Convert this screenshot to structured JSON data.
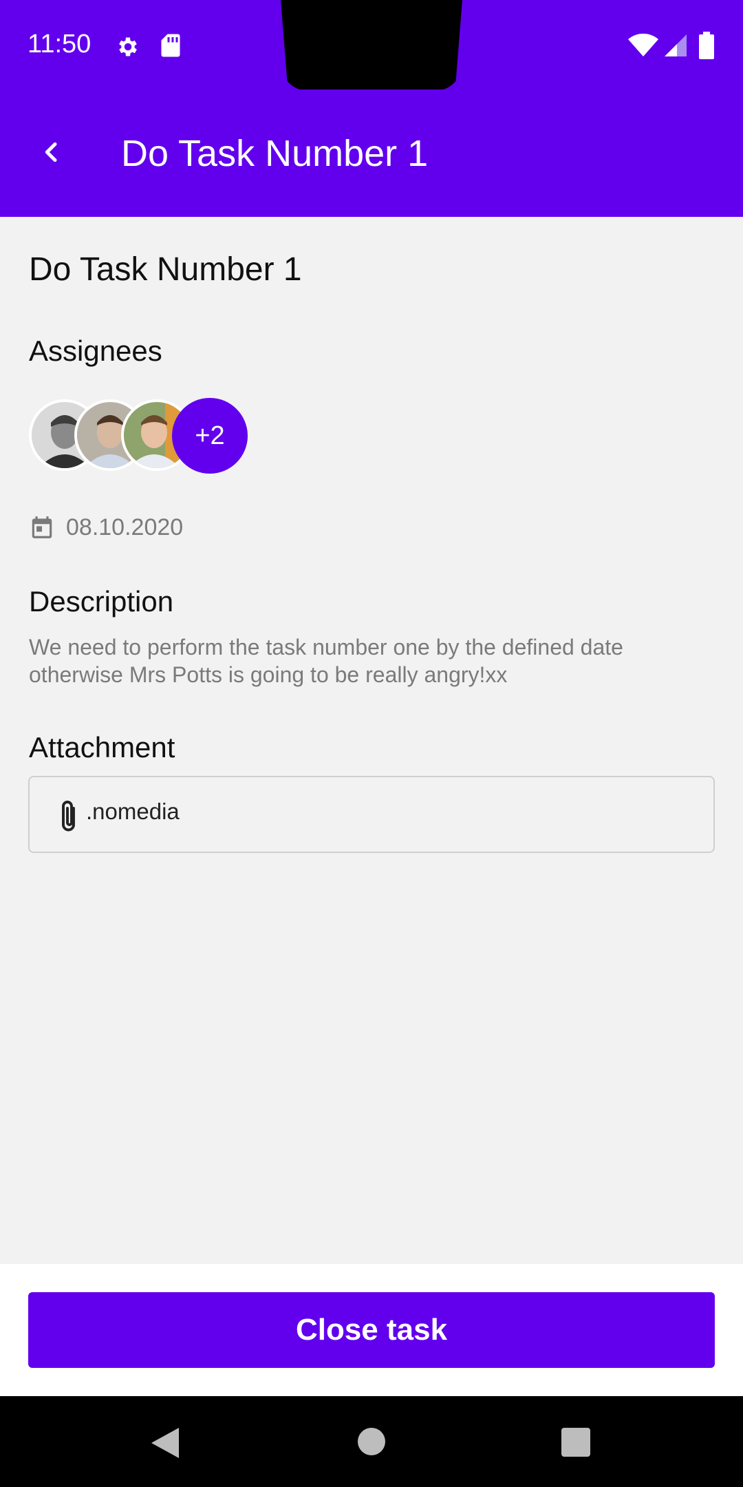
{
  "status_bar": {
    "time": "11:50",
    "icons": [
      "settings-icon",
      "sd-card-icon",
      "wifi-icon",
      "signal-icon",
      "battery-icon"
    ],
    "color": "#6200ee"
  },
  "app_bar": {
    "back_icon": "chevron-left-icon",
    "title": "Do Task Number 1"
  },
  "task": {
    "title": "Do Task Number 1",
    "assignees_heading": "Assignees",
    "assignees": {
      "avatars": [
        "avatar-person-1",
        "avatar-person-2",
        "avatar-person-3"
      ],
      "more_count": "+2"
    },
    "date": "08.10.2020",
    "description_heading": "Description",
    "description": "We need to perform the task number one by the defined date otherwise Mrs Potts is going to be really angry!xx",
    "attachment_heading": "Attachment",
    "attachment": {
      "icon": "paperclip-icon",
      "name": ".nomedia"
    }
  },
  "actions": {
    "close_task_label": "Close task"
  },
  "nav_bar": {
    "icons": [
      "nav-back-icon",
      "nav-home-icon",
      "nav-recents-icon"
    ]
  },
  "colors": {
    "accent": "#6200ee",
    "background": "#f2f2f2",
    "secondary_text": "#7a7a7a"
  }
}
